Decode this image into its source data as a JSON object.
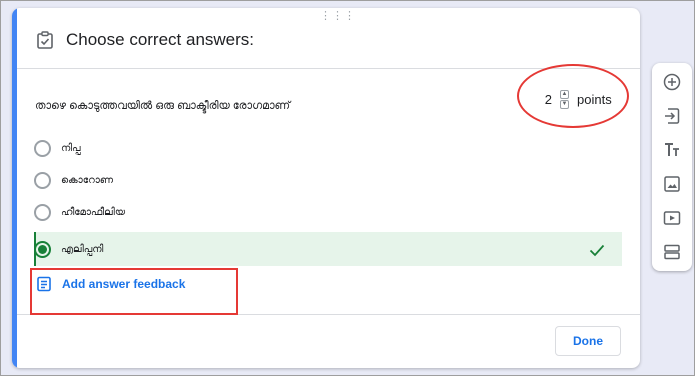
{
  "card": {
    "title": "Choose correct answers:",
    "question": "താഴെ കൊടുത്തവയിൽ ഒരു ബാക്ടീരിയ രോഗമാണ്",
    "points_value": "2",
    "points_label": "points",
    "options": [
      {
        "label": "നിപ്പ",
        "selected": false
      },
      {
        "label": "കൊറോണ",
        "selected": false
      },
      {
        "label": "ഹീമോഫീലിയ",
        "selected": false
      },
      {
        "label": "എലിപ്പനി",
        "selected": true
      }
    ],
    "feedback_label": "Add answer feedback",
    "done_label": "Done"
  },
  "colors": {
    "accent": "#4285f4",
    "correct_bg": "#e6f4ea",
    "correct": "#188038",
    "link": "#1a73e8",
    "annotation": "#e53935"
  },
  "toolbar": {
    "icons": [
      "add-question-icon",
      "import-questions-icon",
      "add-title-icon",
      "add-image-icon",
      "add-video-icon",
      "add-section-icon"
    ]
  }
}
